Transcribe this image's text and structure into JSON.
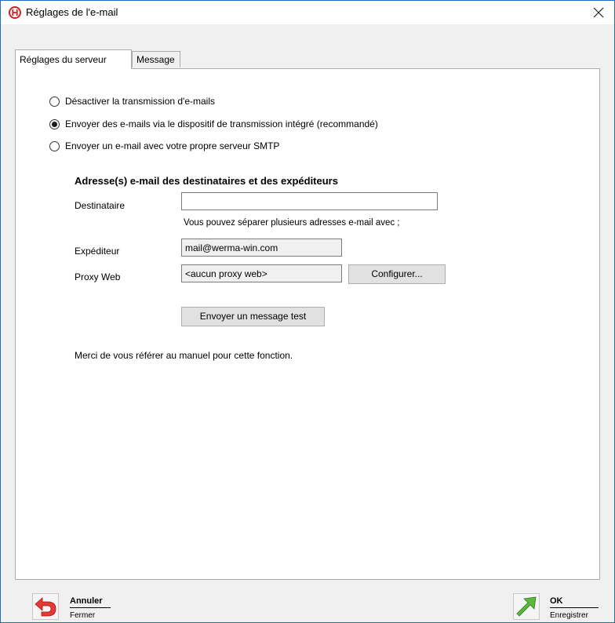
{
  "window": {
    "title": "Réglages de l'e-mail",
    "close_glyph": "✕",
    "logo_icon": "werma-logo-icon"
  },
  "tabs": [
    {
      "label": "Réglages du serveur",
      "active": true
    },
    {
      "label": "Message",
      "active": false
    }
  ],
  "server": {
    "radios": [
      {
        "label": "Désactiver la transmission d'e-mails",
        "checked": false
      },
      {
        "label": "Envoyer des e-mails via le dispositif de transmission intégré (recommandé)",
        "checked": true
      },
      {
        "label": "Envoyer un e-mail avec votre propre serveur SMTP",
        "checked": false
      }
    ],
    "section_title": "Adresse(s) e-mail des destinataires et des expéditeurs",
    "recipient_label": "Destinataire",
    "recipient_value": "",
    "recipient_hint": "Vous pouvez séparer plusieurs adresses e-mail avec ;",
    "sender_label": "Expéditeur",
    "sender_value": "mail@werma-win.com",
    "proxy_label": "Proxy Web",
    "proxy_value": "<aucun proxy web>",
    "configure_label": "Configurer...",
    "test_label": "Envoyer un message test",
    "note": "Merci de vous référer au manuel pour cette fonction."
  },
  "footer": {
    "cancel": {
      "label": "Annuler",
      "sub": "Fermer",
      "icon": "undo-arrow-icon",
      "color": "#e53935"
    },
    "ok": {
      "label": "OK",
      "sub": "Enregistrer",
      "icon": "green-arrow-icon",
      "color": "#5cb83c"
    }
  },
  "colors": {
    "window_border": "#1e6fbf",
    "dialog_bg": "#f0f0f0",
    "panel_bg": "#ffffff"
  }
}
